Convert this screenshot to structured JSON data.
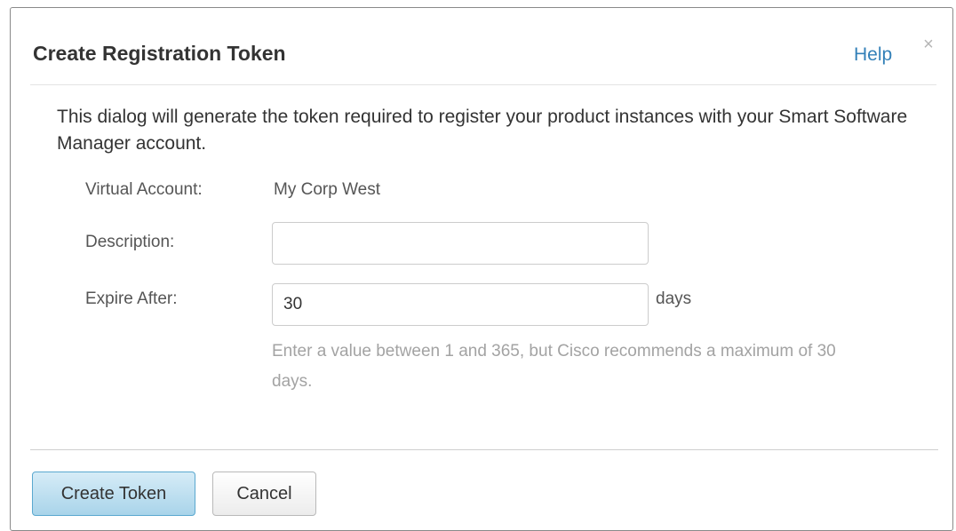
{
  "dialog": {
    "title": "Create Registration Token",
    "help_label": "Help",
    "close_glyph": "×",
    "intro": "This dialog will generate the token required to register your product instances with your Smart Software Manager account."
  },
  "form": {
    "virtual_account": {
      "label": "Virtual Account:",
      "value": "My Corp West"
    },
    "description": {
      "label": "Description:",
      "value": "",
      "placeholder": ""
    },
    "expire_after": {
      "label": "Expire After:",
      "value": "30",
      "unit": "days",
      "hint": "Enter a value between 1 and 365, but Cisco recommends a maximum of 30 days."
    }
  },
  "footer": {
    "create_label": "Create Token",
    "cancel_label": "Cancel"
  },
  "colors": {
    "link": "#3380b8",
    "primary_button_top": "#d6ecf7",
    "primary_button_bottom": "#a9d4ea",
    "primary_button_border": "#5aa8cf",
    "hint_text": "#a3a3a3"
  },
  "icons": {
    "close": "close-icon"
  }
}
